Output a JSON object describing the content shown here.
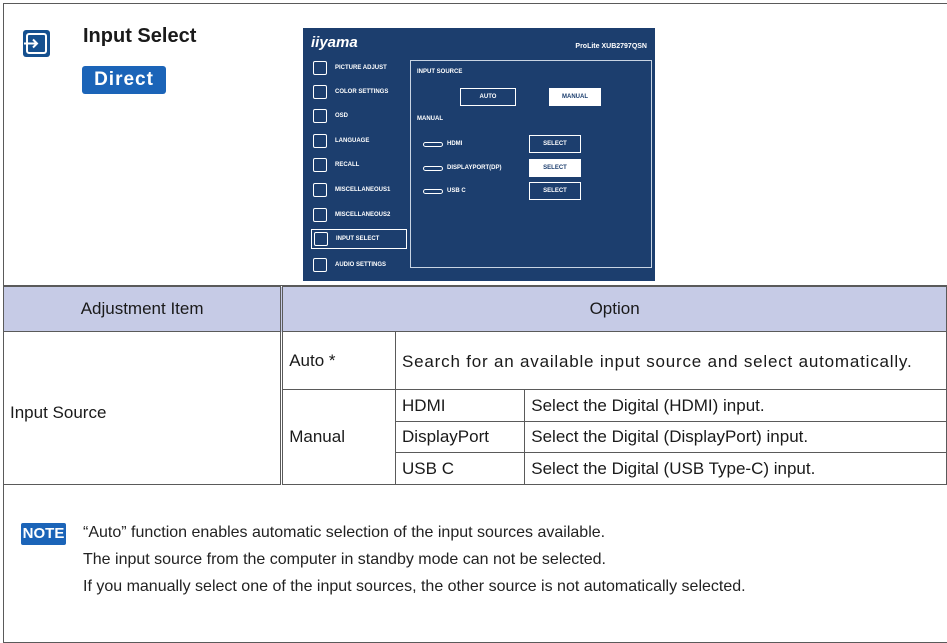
{
  "section": {
    "title": "Input Select",
    "badge": "Direct",
    "icon": "input-select-icon"
  },
  "osd": {
    "brand": "iiyama",
    "model": "ProLite XUB2797QSN",
    "menu": [
      {
        "label": "PICTURE ADJUST",
        "icon": "sun-icon"
      },
      {
        "label": "COLOR SETTINGS",
        "icon": "palette-icon"
      },
      {
        "label": "OSD",
        "icon": "osd-icon"
      },
      {
        "label": "LANGUAGE",
        "icon": "globe-icon"
      },
      {
        "label": "RECALL",
        "icon": "recall-icon"
      },
      {
        "label": "MISCELLANEOUS1",
        "icon": "sliders-icon"
      },
      {
        "label": "MISCELLANEOUS2",
        "icon": "sliders-icon"
      },
      {
        "label": "INPUT SELECT",
        "icon": "input-icon"
      },
      {
        "label": "AUDIO SETTINGS",
        "icon": "speaker-icon"
      }
    ],
    "input_source_label": "INPUT SOURCE",
    "auto_label": "AUTO",
    "manual_btn_label": "MANUAL",
    "manual_label": "MANUAL",
    "ports": [
      {
        "name": "HDMI",
        "button": "SELECT"
      },
      {
        "name": "DISPLAYPORT(DP)",
        "button": "SELECT"
      },
      {
        "name": "USB C",
        "button": "SELECT"
      }
    ]
  },
  "table": {
    "header_item": "Adjustment Item",
    "header_option": "Option",
    "item": "Input Source",
    "auto_label": "Auto *",
    "auto_desc": "Search for an available input source and select automatically.",
    "manual_label": "Manual",
    "manual_rows": [
      {
        "port": "HDMI",
        "desc": "Select the Digital (HDMI) input."
      },
      {
        "port": "DisplayPort",
        "desc": "Select the Digital (DisplayPort) input."
      },
      {
        "port": "USB C",
        "desc": "Select the Digital (USB Type-C) input."
      }
    ]
  },
  "note": {
    "badge": "NOTE",
    "lines": [
      "“Auto” function enables automatic selection of the input sources available.",
      "The input source from the computer in standby mode can not be selected.",
      "If you manually select one of the input sources, the other source is not automatically selected."
    ]
  },
  "colors": {
    "header_bg": "#c6cbe6",
    "badge_blue": "#1b64b8",
    "osd_bg": "#1c3e6e"
  }
}
